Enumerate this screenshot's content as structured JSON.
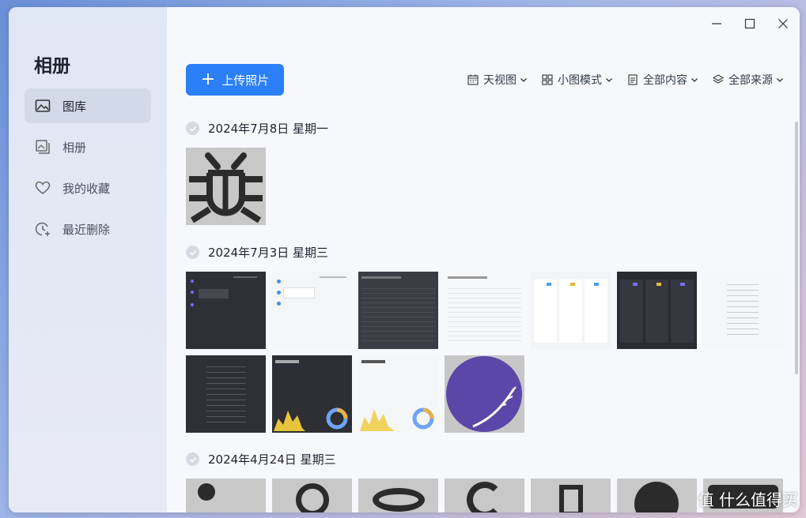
{
  "app": {
    "title": "相册"
  },
  "sidebar": {
    "items": [
      {
        "label": "图库",
        "icon": "image-icon",
        "active": true
      },
      {
        "label": "相册",
        "icon": "album-icon",
        "active": false
      },
      {
        "label": "我的收藏",
        "icon": "heart-icon",
        "active": false
      },
      {
        "label": "最近删除",
        "icon": "recent-delete-icon",
        "active": false
      }
    ]
  },
  "toolbar": {
    "upload_label": "上传照片",
    "view_by": "天视图",
    "mode": "小图模式",
    "content": "全部内容",
    "source": "全部来源"
  },
  "groups": [
    {
      "date": "2024年7月8日  星期一",
      "count": 1
    },
    {
      "date": "2024年7月3日  星期三",
      "count": 11
    },
    {
      "date": "2024年4月24日  星期三",
      "count": 7
    }
  ],
  "watermark": "值 什么值得买",
  "colors": {
    "accent": "#2b7ff7",
    "sidebar_active": "#d2d9e8",
    "purple": "#5a47a8"
  }
}
